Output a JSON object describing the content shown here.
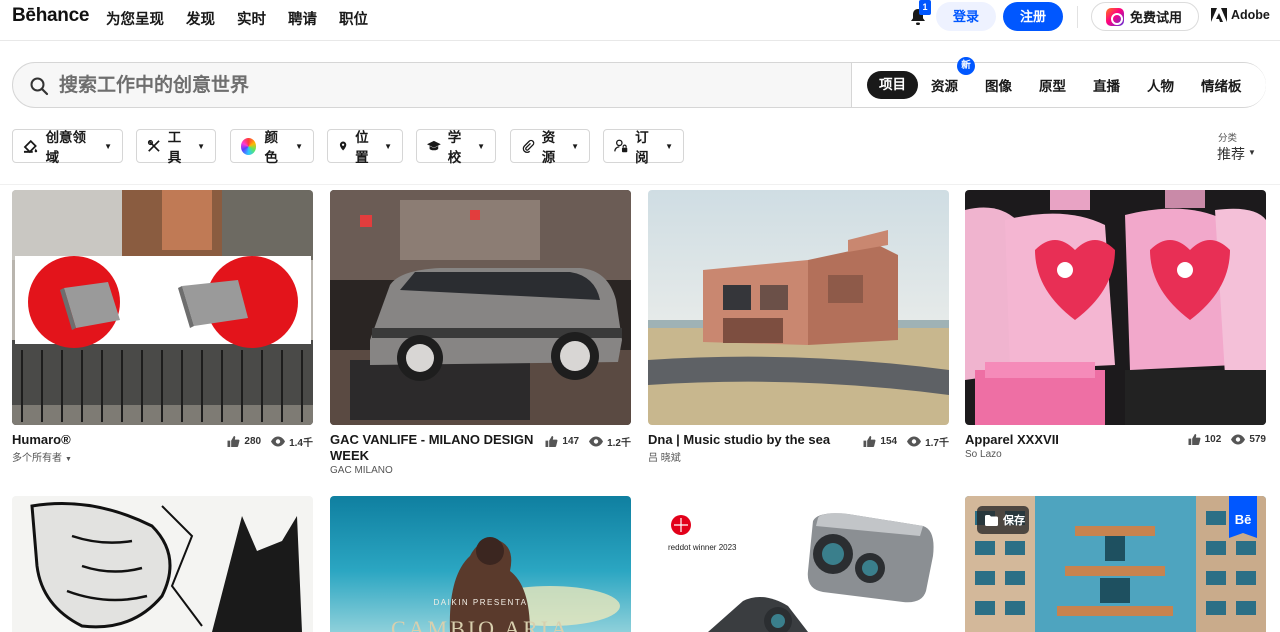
{
  "nav": {
    "logo": "Bēhance",
    "links": [
      "为您呈现",
      "发现",
      "实时",
      "聘请",
      "职位"
    ],
    "notification_count": "1",
    "login": "登录",
    "signup": "注册",
    "trial": "免费试用",
    "adobe": "Adobe"
  },
  "search": {
    "placeholder": "搜索工作中的创意世界",
    "tabs": [
      "项目",
      "资源",
      "图像",
      "原型",
      "直播",
      "人物",
      "情绪板"
    ],
    "active_tab": "项目",
    "new_badge": "新"
  },
  "filters": [
    "创意领域",
    "工具",
    "颜色",
    "位置",
    "学校",
    "资源",
    "订阅"
  ],
  "sort": {
    "label": "分类",
    "value": "推荐"
  },
  "projects": [
    {
      "title": "Humaro®",
      "owner": "多个所有者",
      "likes": "280",
      "views": "1.4千"
    },
    {
      "title": "GAC VANLIFE - MILANO DESIGN WEEK",
      "owner": "GAC MILANO",
      "likes": "147",
      "views": "1.2千"
    },
    {
      "title": "Dna | Music studio by the sea",
      "owner": "吕 晓斌",
      "likes": "154",
      "views": "1.7千"
    },
    {
      "title": "Apparel XXXVII",
      "owner": "So Lazo",
      "likes": "102",
      "views": "579"
    }
  ],
  "row2": {
    "daikin": "DAIKIN PRESENTA",
    "cambio": "CAMBIO ARIA",
    "reddot": "reddot winner 2023",
    "save": "保存",
    "be": "Bē"
  },
  "colors": {
    "accent": "#0057ff",
    "dark": "#191919"
  }
}
